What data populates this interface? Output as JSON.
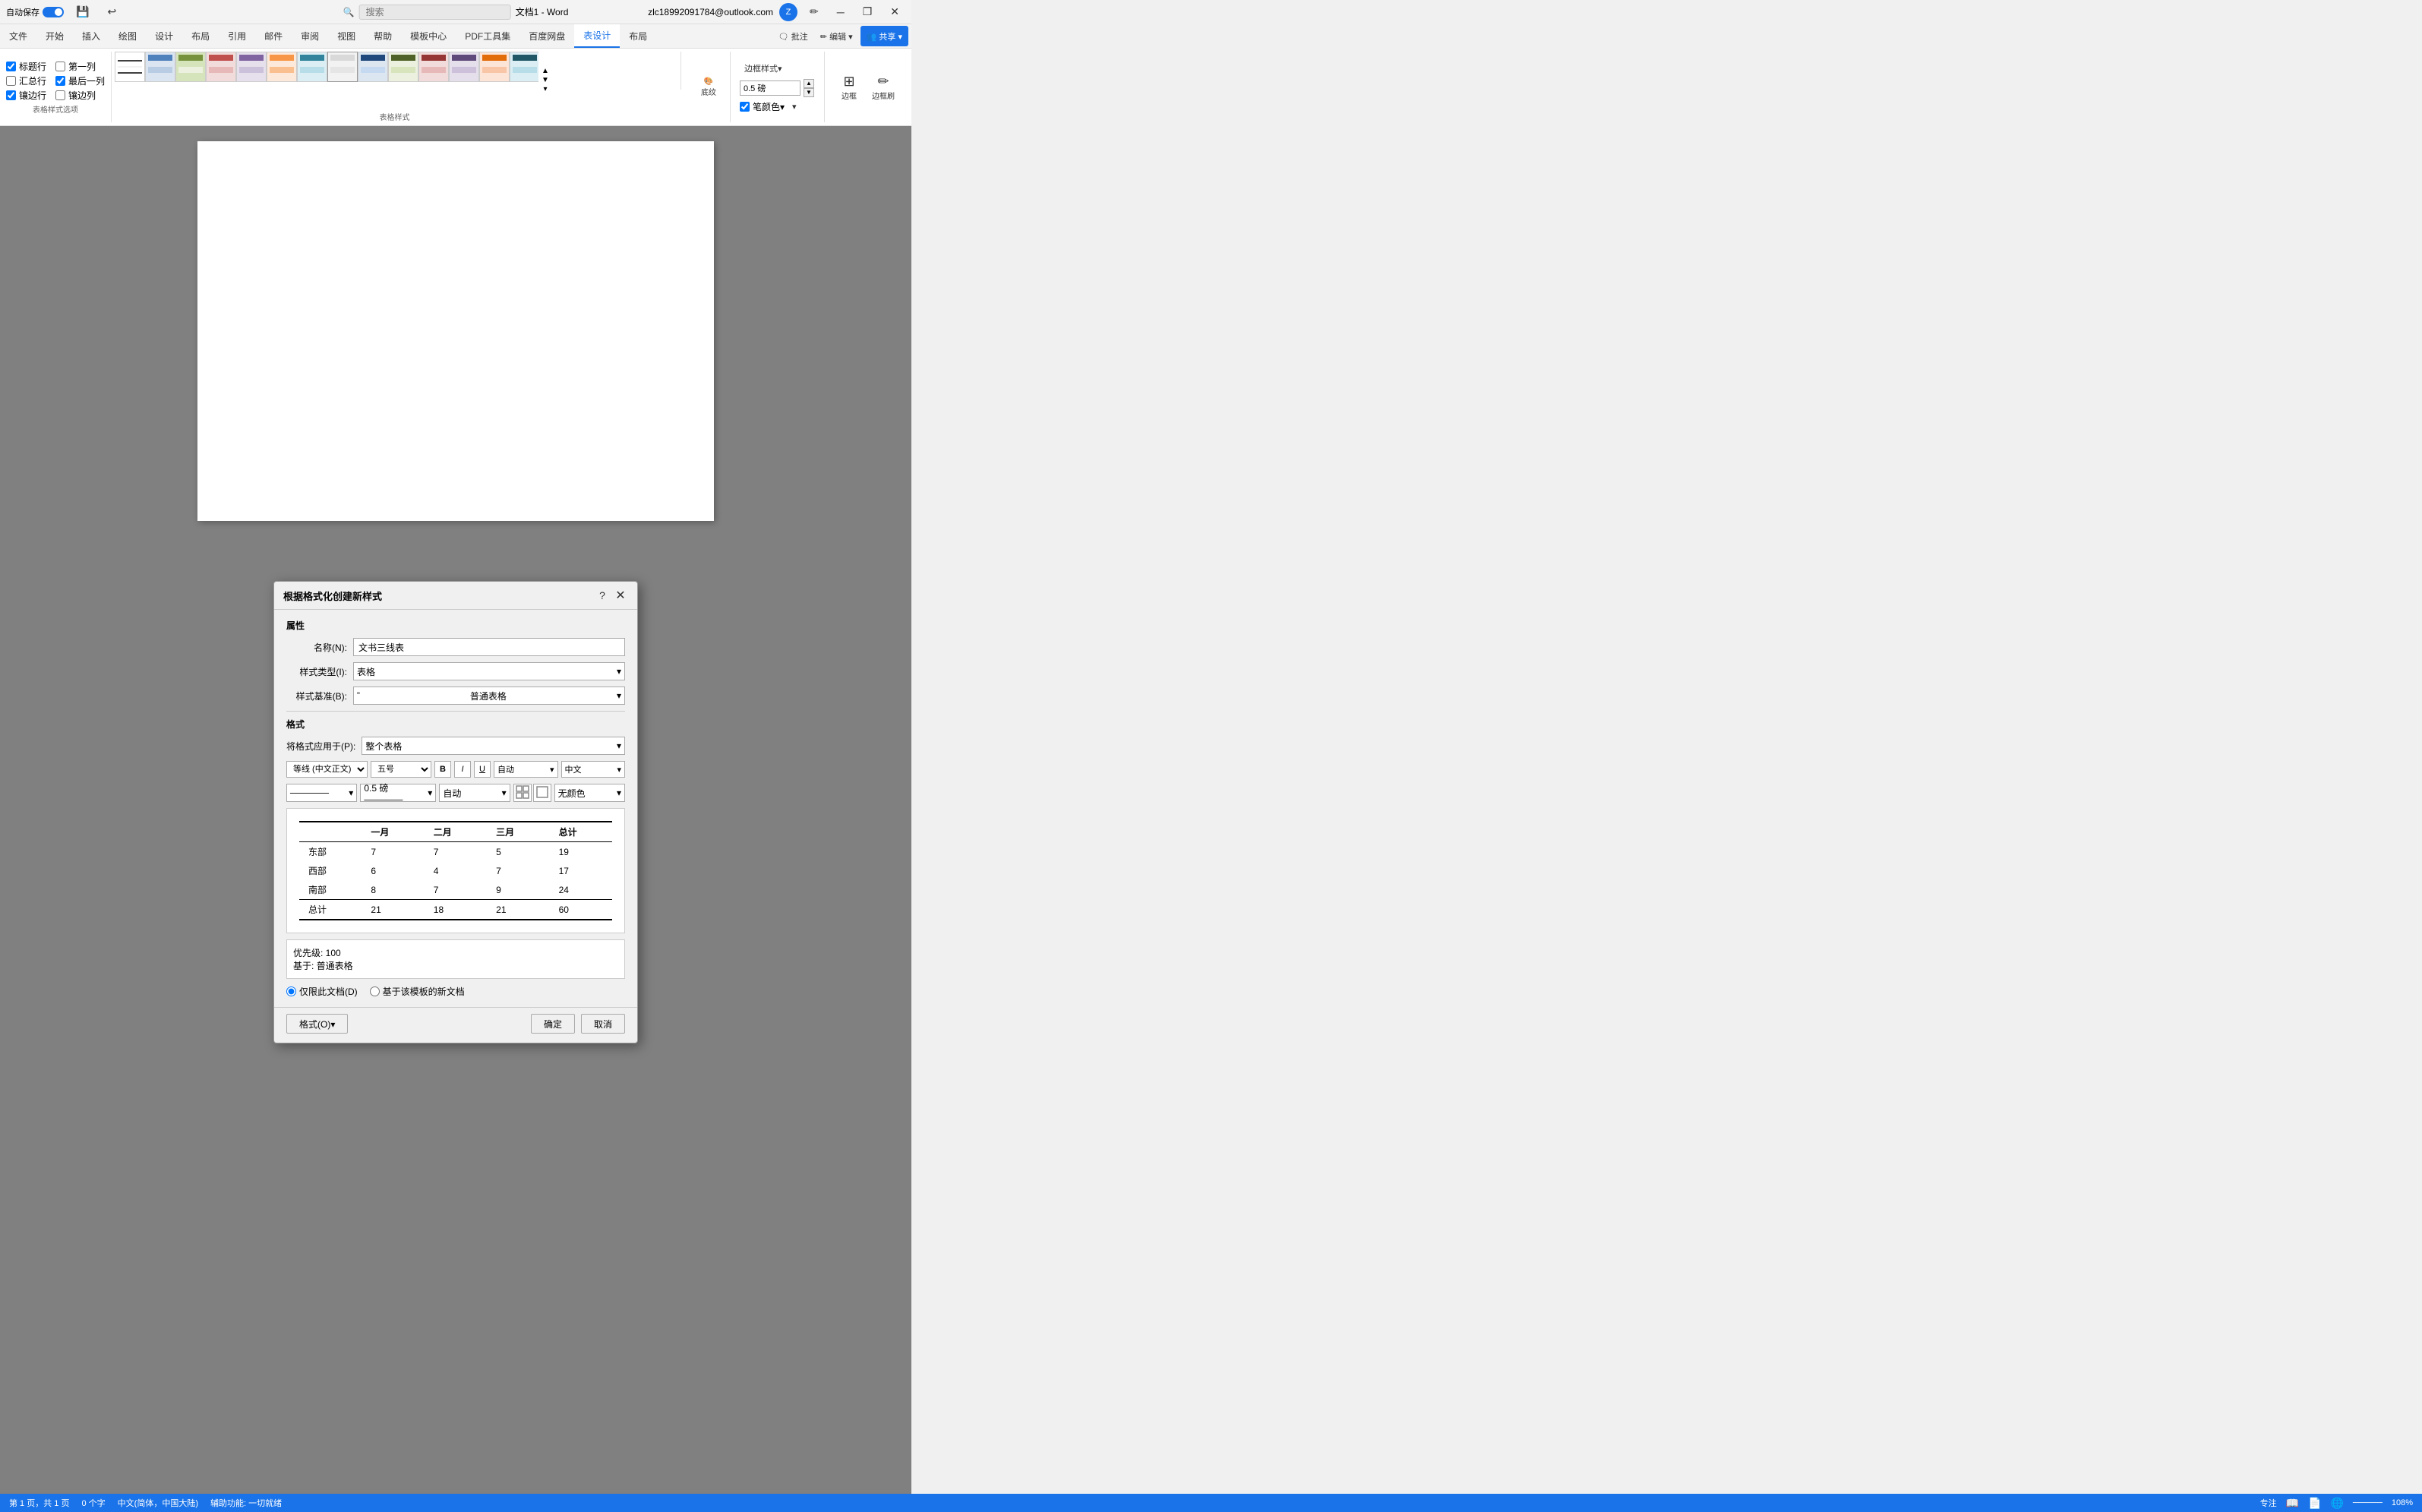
{
  "titlebar": {
    "autosave_label": "自动保存",
    "autosave_on": "●",
    "doc_title": "文档1 - Word",
    "user_email": "zlc18992091784@outlook.com",
    "user_initial": "Z",
    "search_placeholder": "搜索",
    "buttons": {
      "minimize": "─",
      "restore": "❐",
      "close": "✕"
    }
  },
  "ribbon": {
    "tabs": [
      "文件",
      "开始",
      "插入",
      "绘图",
      "设计",
      "布局",
      "引用",
      "邮件",
      "审阅",
      "视图",
      "帮助",
      "模板中心",
      "PDF工具集",
      "百度网盘",
      "表设计",
      "布局"
    ],
    "active_tab": "表设计",
    "toolbar_right": {
      "comment": "批注",
      "edit": "编辑▾",
      "share": "共享▾"
    },
    "table_style_options": {
      "shading_label": "底纹",
      "border_styles_label": "边框样式▾",
      "border_thickness_label": "0.5 磅",
      "border_color_label": "笔颜色▾",
      "border_label": "边框",
      "border_painter_label": "边框刷"
    },
    "checkboxes": [
      {
        "label": "标题行",
        "checked": true
      },
      {
        "label": "第一列",
        "checked": false
      },
      {
        "label": "汇总行",
        "checked": false
      },
      {
        "label": "最后一列",
        "checked": true
      },
      {
        "label": "镶边行",
        "checked": true
      },
      {
        "label": "镶边列",
        "checked": false
      }
    ],
    "checkbox_section_label": "表格样式选项",
    "gallery_section_label": "表格样式"
  },
  "dialog": {
    "title": "根据格式化创建新样式",
    "properties_label": "属性",
    "name_label": "名称(N):",
    "name_value": "文书三线表",
    "style_type_label": "样式类型(I):",
    "style_type_value": "表格",
    "style_base_label": "样式基准(B):",
    "style_base_value": "普通表格",
    "format_label": "格式",
    "apply_to_label": "将格式应用于(P):",
    "apply_to_value": "整个表格",
    "font_label": "等线 (中文正文)",
    "size_label": "五号",
    "color_label": "自动",
    "lang_label": "中文",
    "border_style_label": "──────",
    "border_width_label": "0.5 磅 ──────",
    "border_auto_label": "自动",
    "border_color_btn": "无颜色",
    "preview": {
      "header": [
        "",
        "一月",
        "二月",
        "三月",
        "总计"
      ],
      "rows": [
        [
          "东部",
          "7",
          "7",
          "5",
          "19"
        ],
        [
          "西部",
          "6",
          "4",
          "7",
          "17"
        ],
        [
          "南部",
          "8",
          "7",
          "9",
          "24"
        ],
        [
          "总计",
          "21",
          "18",
          "21",
          "60"
        ]
      ]
    },
    "priority_text": "优先级: 100",
    "base_text": "    基于: 普通表格",
    "radio_options": [
      {
        "label": "仅限此文档(D)",
        "value": "this_doc",
        "checked": true
      },
      {
        "label": "基于该模板的新文档",
        "value": "template",
        "checked": false
      }
    ],
    "format_btn": "格式(O)▾",
    "confirm_btn": "确定",
    "cancel_btn": "取消"
  },
  "status_bar": {
    "page_info": "第 1 页，共 1 页",
    "word_count": "0 个字",
    "lang": "中文(简体，中国大陆)",
    "accessibility": "辅助功能: 一切就绪",
    "focus_mode": "专注",
    "read_mode": "",
    "print_layout": "",
    "web_layout": "",
    "zoom": "108%"
  }
}
